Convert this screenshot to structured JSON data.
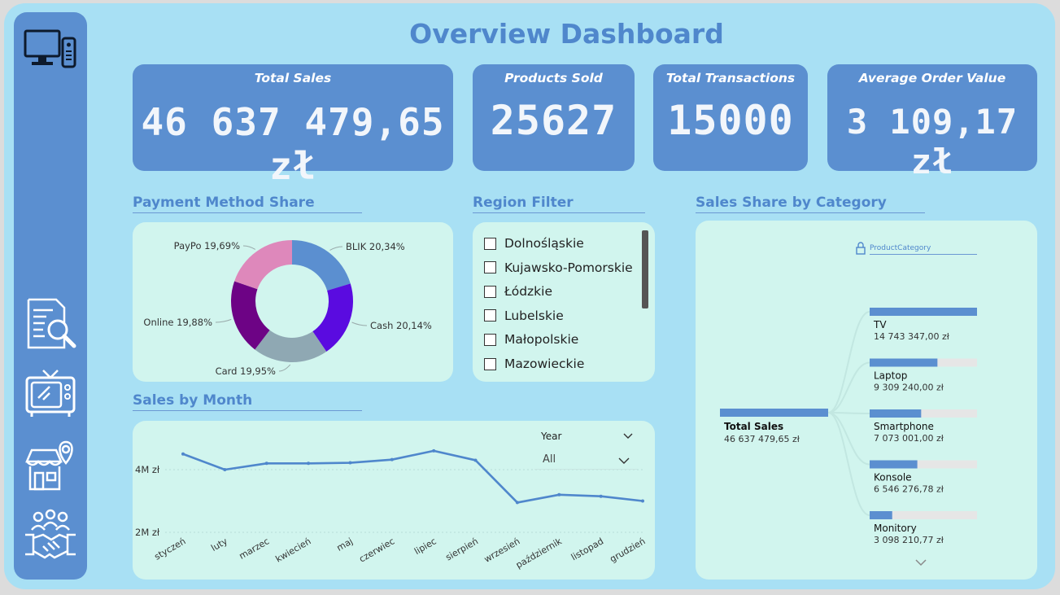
{
  "title": "Overview Dashboard",
  "sidebar": {
    "icons": [
      "tv-remote-icon",
      "report-search-icon",
      "retro-tv-icon",
      "store-location-icon",
      "handshake-team-icon"
    ]
  },
  "kpis": [
    {
      "label": "Total Sales",
      "value": "46 637 479,65 zł"
    },
    {
      "label": "Products Sold",
      "value": "25627"
    },
    {
      "label": "Total Transactions",
      "value": "15000"
    },
    {
      "label": "Average Order Value",
      "value": "3 109,17 zł"
    }
  ],
  "payment": {
    "title": "Payment Method Share",
    "chart_data": {
      "type": "pie",
      "categories": [
        "BLIK",
        "Cash",
        "Card",
        "Online",
        "PayPo"
      ],
      "values": [
        20.34,
        20.14,
        19.95,
        19.88,
        19.69
      ],
      "labels": [
        "BLIK 20,34%",
        "Cash 20,14%",
        "Card 19,95%",
        "Online 19,88%",
        "PayPo 19,69%"
      ],
      "colors": [
        "#5b8fd0",
        "#5a0be0",
        "#8fa8b3",
        "#6d0385",
        "#de88bb"
      ]
    }
  },
  "region": {
    "title": "Region Filter",
    "items": [
      "Dolnośląskie",
      "Kujawsko-Pomorskie",
      "Łódzkie",
      "Lubelskie",
      "Małopolskie",
      "Mazowieckie"
    ]
  },
  "monthly": {
    "title": "Sales by Month",
    "slicer_label": "Year",
    "slicer_value": "All",
    "chart_data": {
      "type": "line",
      "categories": [
        "styczeń",
        "luty",
        "marzec",
        "kwiecień",
        "maj",
        "czerwiec",
        "lipiec",
        "sierpień",
        "wrzesień",
        "październik",
        "listopad",
        "grudzień"
      ],
      "values": [
        4.5,
        4.0,
        4.2,
        4.2,
        4.22,
        4.32,
        4.6,
        4.3,
        2.95,
        3.2,
        3.15,
        3.0
      ],
      "yticks": [
        "2M zł",
        "4M zł"
      ],
      "color": "#4f87cc"
    }
  },
  "category": {
    "title": "Sales Share by Category",
    "field_label": "ProductCategory",
    "root": {
      "label": "Total Sales",
      "value": "46 637 479,65 zł"
    },
    "chart_data": {
      "type": "bar",
      "categories": [
        "TV",
        "Laptop",
        "Smartphone",
        "Konsole",
        "Monitory"
      ],
      "values": [
        14743347.0,
        9309240.0,
        7073001.0,
        6546276.78,
        3098210.77
      ],
      "value_labels": [
        "14 743 347,00 zł",
        "9 309 240,00 zł",
        "7 073 001,00 zł",
        "6 546 276,78 zł",
        "3 098 210,77 zł"
      ]
    }
  }
}
